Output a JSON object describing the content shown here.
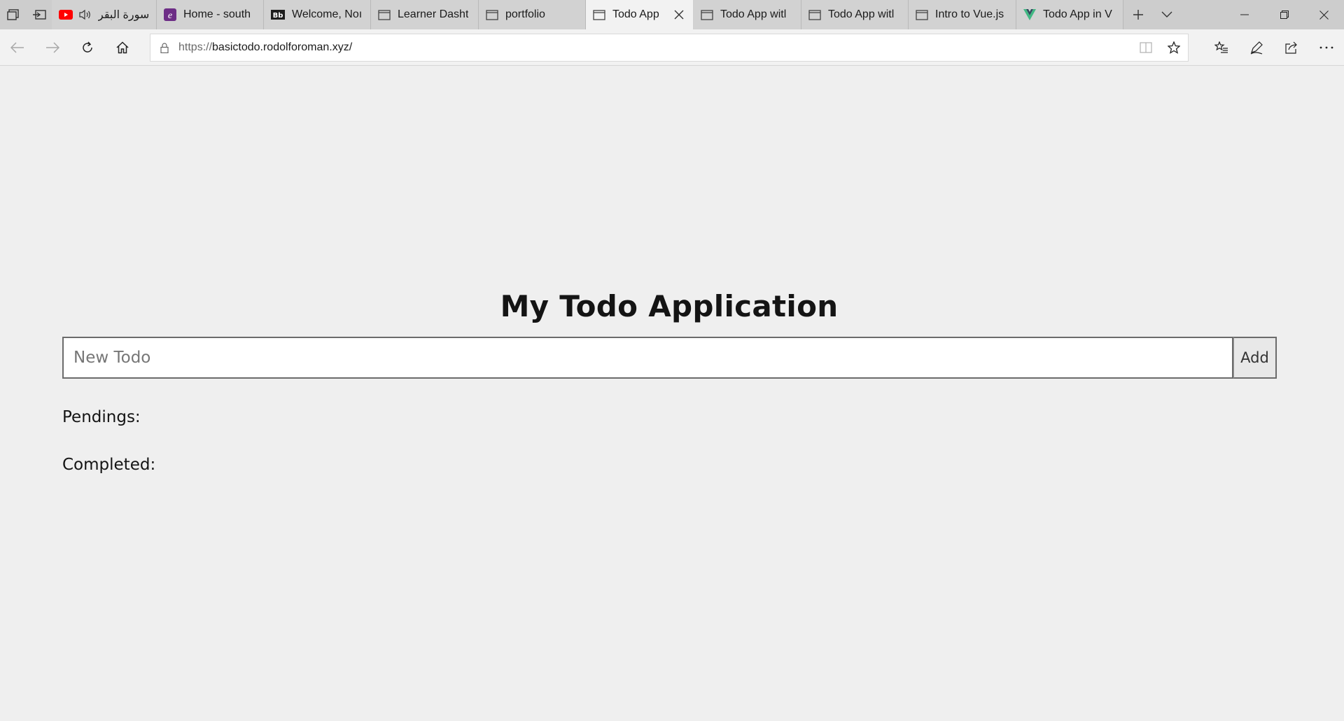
{
  "browser": {
    "tabs": [
      {
        "title": "سورة البقر",
        "icon": "youtube-icon",
        "audio": true
      },
      {
        "title": "Home - south",
        "icon": "e-logo-icon"
      },
      {
        "title": "Welcome, Noı",
        "icon": "site-logo-icon"
      },
      {
        "title": "Learner Dasht",
        "icon": "page-icon"
      },
      {
        "title": "portfolio",
        "icon": "page-icon"
      },
      {
        "title": "Todo App",
        "icon": "page-icon",
        "active": true
      },
      {
        "title": "Todo App witl",
        "icon": "page-icon"
      },
      {
        "title": "Todo App witl",
        "icon": "page-icon"
      },
      {
        "title": "Intro to Vue.js",
        "icon": "page-icon"
      },
      {
        "title": "Todo App in V",
        "icon": "vue-icon"
      }
    ],
    "url_scheme": "https://",
    "url_host": "basictodo.rodolforoman.xyz/",
    "accent": "#0078d7"
  },
  "app": {
    "title": "My Todo Application",
    "input_placeholder": "New Todo",
    "add_label": "Add",
    "pending_label": "Pendings:",
    "completed_label": "Completed:"
  }
}
